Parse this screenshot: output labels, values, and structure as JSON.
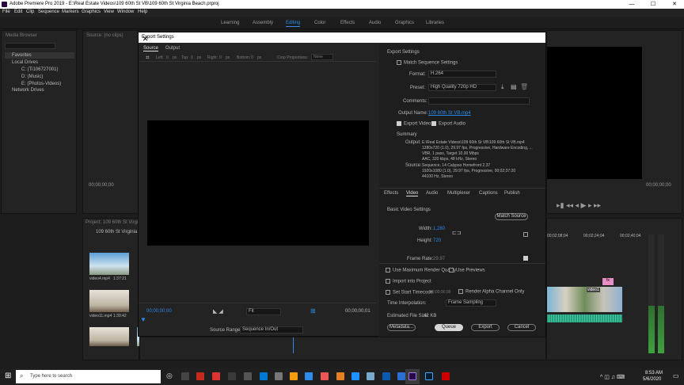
{
  "window": {
    "title": "Adobe Premiere Pro 2019 - E:\\Real Estate Videos\\109 60th St VB\\109 60th St Virginia Beach.prproj",
    "minimize": "—",
    "maximize": "☐",
    "close": "✕"
  },
  "menu": [
    "File",
    "Edit",
    "Clip",
    "Sequence",
    "Markers",
    "Graphics",
    "View",
    "Window",
    "Help"
  ],
  "workspaces": [
    "Learning",
    "Assembly",
    "Editing",
    "Color",
    "Effects",
    "Audio",
    "Graphics",
    "Libraries"
  ],
  "media_browser": {
    "tab": "Media Browser",
    "items": [
      "Favorites",
      "Local Drives",
      "C: (Ti106727001)",
      "D: (Music)",
      "E: (Photos-Videos)",
      "Network Drives"
    ]
  },
  "source_tab": "Source: (no clips)",
  "source_timecode": "00;00;00;00",
  "project": {
    "tab": "Project: 109 60th St Virginia Beach",
    "bin": "109 60th St Virginia Beac",
    "clips": [
      {
        "name": "video4.mp4",
        "dur": "1:37:21"
      },
      {
        "name": "video11.mp4",
        "dur": "1:39:42"
      }
    ]
  },
  "program": {
    "timecode_left": "00;00;00;00",
    "timecode_right": "00;00;00;00"
  },
  "timeline": {
    "ticks": [
      "00;02;08;04",
      "00;02;24;04",
      "00;02;40;04"
    ],
    "clip_label": "video1",
    "fx": "fx"
  },
  "dialog": {
    "title": "Export Settings",
    "close": "✕",
    "tabs": [
      "Source",
      "Output"
    ],
    "crop": [
      "Left:",
      "0",
      "px",
      "Top:",
      "0",
      "px",
      "Right:",
      "0",
      "px",
      "Bottom:",
      "0",
      "px",
      "Crop Proportions:",
      "None"
    ],
    "timecode_left": "00;00;00;00",
    "timecode_right": "00;00;00;01",
    "fit": "Fit",
    "source_range_label": "Source Range:",
    "source_range_value": "Sequence In/Out",
    "export_settings_header": "Export Settings",
    "match_sequence": "Match Sequence Settings",
    "format_label": "Format:",
    "format_value": "H.264",
    "preset_label": "Preset:",
    "preset_value": "High Quality 720p HD",
    "comments_label": "Comments:",
    "output_name_label": "Output Name:",
    "output_name_value": "109 60th St VB.mp4",
    "export_video": "Export Video",
    "export_audio": "Export Audio",
    "summary_header": "Summary",
    "output_label": "Output:",
    "output_lines": [
      "E:\\Real Estate Videos\\109 60th St VB\\109 60th St VB.mp4",
      "1280x720 (1.0), 29.97 fps, Progressive, Hardware Encoding, ...",
      "VBR, 1 pass, Target 10.00 Mbps",
      "AAC, 320 kbps, 48 kHz, Stereo"
    ],
    "source_label": "Source:",
    "source_lines": [
      "Sequence, 14 Calypso Homefront 2.37",
      "1920x1080 (1.0), 29.97 fps, Progressive, 00;02;37;20",
      "44100 Hz, Stereo"
    ],
    "settings_tabs": [
      "Effects",
      "Video",
      "Audio",
      "Multiplexer",
      "Captions",
      "Publish"
    ],
    "basic_video_header": "Basic Video Settings",
    "match_source": "Match Source",
    "width_label": "Width:",
    "width_value": "1,280",
    "height_label": "Height:",
    "height_value": "720",
    "frame_rate_label": "Frame Rate:",
    "frame_rate_value": "29.97",
    "use_max_render": "Use Maximum Render Quality",
    "use_previews": "Use Previews",
    "import_into_project": "Import into Project",
    "set_start_timecode": "Set Start Timecode",
    "start_timecode_value": "00;00;00;00",
    "render_alpha": "Render Alpha Channel Only",
    "time_interp_label": "Time Interpolation:",
    "time_interp_value": "Frame Sampling",
    "est_size_label": "Estimated File Size:",
    "est_size_value": "42 KB",
    "buttons": {
      "metadata": "Metadata...",
      "queue": "Queue",
      "export": "Export",
      "cancel": "Cancel"
    }
  },
  "taskbar": {
    "search_placeholder": "Type here to search",
    "time": "8:53 AM",
    "date": "5/6/2020"
  }
}
